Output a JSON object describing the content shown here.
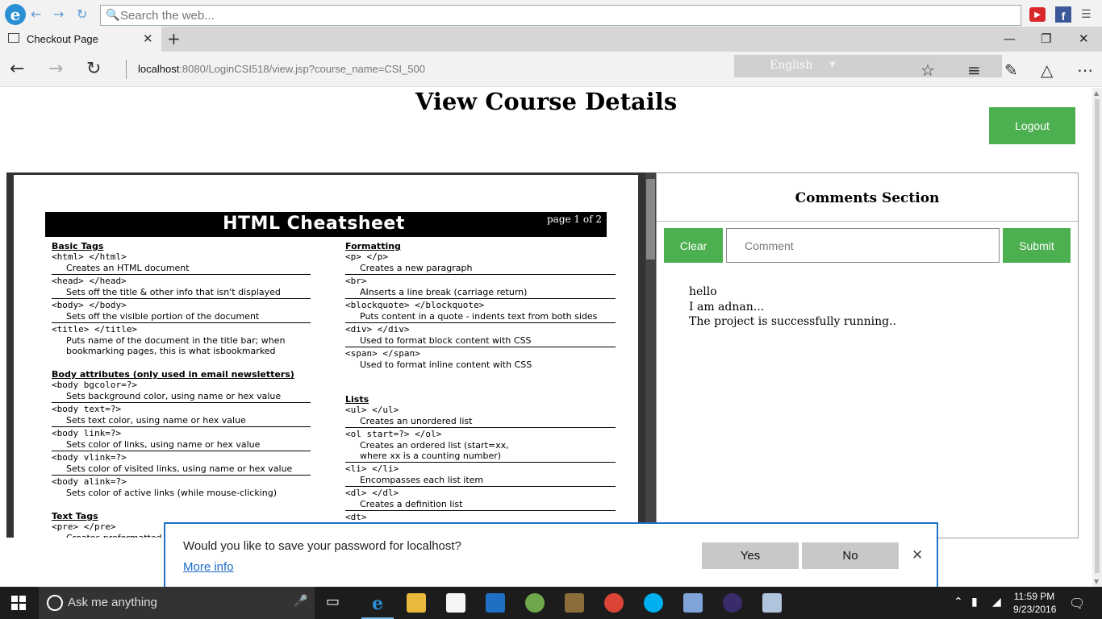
{
  "search": {
    "placeholder": "Search the web..."
  },
  "tab": {
    "title": "Checkout Page"
  },
  "address": {
    "host": "localhost",
    "rest": ":8080/LoginCSI518/view.jsp?course_name=CSI_500"
  },
  "toolbar": {
    "language": "English"
  },
  "page": {
    "title": "View Course Details",
    "logout_label": "Logout"
  },
  "cheatsheet": {
    "title": "HTML Cheatsheet",
    "page_label": "page 1 of 2",
    "left": [
      {
        "section": "Basic Tags",
        "entries": [
          {
            "tag": "<html> </html>",
            "desc": [
              "Creates an HTML document"
            ]
          },
          {
            "tag": "<head> </head>",
            "desc": [
              "Sets off the title & other info that isn't displayed"
            ]
          },
          {
            "tag": "<body> </body>",
            "desc": [
              "Sets off the visible portion of the document"
            ]
          },
          {
            "tag": "<title> </title>",
            "desc": [
              "Puts name of the document in the title bar; when",
              "bookmarking pages, this is what isbookmarked"
            ]
          }
        ]
      },
      {
        "section": "Body attributes",
        "section_extra": " (only used in email newsletters)",
        "entries": [
          {
            "tag": "<body bgcolor=?>",
            "desc": [
              "Sets background color, using name or hex value"
            ]
          },
          {
            "tag": "<body text=?>",
            "desc": [
              "Sets text color, using name or hex value"
            ]
          },
          {
            "tag": "<body link=?>",
            "desc": [
              "Sets color of links, using name or hex value"
            ]
          },
          {
            "tag": "<body vlink=?>",
            "desc": [
              "Sets color of visited links, using name or hex value"
            ]
          },
          {
            "tag": "<body alink=?>",
            "desc": [
              "Sets color of active links (while mouse-clicking)"
            ]
          }
        ]
      },
      {
        "section": "Text Tags",
        "entries": [
          {
            "tag": "<pre> </pre>",
            "desc": [
              "Creates preformatted"
            ]
          }
        ]
      }
    ],
    "right": [
      {
        "section": "Formatting",
        "entries": [
          {
            "tag": "<p> </p>",
            "desc": [
              "Creates a new paragraph"
            ]
          },
          {
            "tag": "<br>",
            "desc": [
              "AInserts a line break (carriage return)"
            ]
          },
          {
            "tag": "<blockquote> </blockquote>",
            "desc": [
              "Puts content in a quote - indents text from both sides"
            ]
          },
          {
            "tag": "<div> </div>",
            "desc": [
              "Used to format block content with CSS"
            ]
          },
          {
            "tag": "<span> </span>",
            "desc": [
              "Used to format inline content with CSS"
            ]
          }
        ]
      },
      {
        "section": "Lists",
        "entries": [
          {
            "tag": "<ul> </ul>",
            "desc": [
              "Creates an unordered list"
            ]
          },
          {
            "tag": "<ol start=?> </ol>",
            "desc": [
              "Creates an ordered list (start=xx,",
              "where xx is a counting number)"
            ]
          },
          {
            "tag": "<li> </li>",
            "desc": [
              "Encompasses each list item"
            ]
          },
          {
            "tag": "<dl> </dl>",
            "desc": [
              "Creates a definition list"
            ]
          },
          {
            "tag": "<dt>",
            "desc": []
          }
        ]
      }
    ]
  },
  "comments": {
    "title": "Comments Section",
    "clear_label": "Clear",
    "input_placeholder": "Comment",
    "submit_label": "Submit",
    "items": [
      "hello",
      "I am adnan...",
      "The project is successfully running.."
    ]
  },
  "password_prompt": {
    "message": "Would you like to save your password for localhost?",
    "more_info": "More info",
    "yes_label": "Yes",
    "no_label": "No"
  },
  "taskbar": {
    "search_placeholder": "Ask me anything",
    "time": "11:59 PM",
    "date": "9/23/2016"
  },
  "colors": {
    "accent_green": "#4caf50",
    "prompt_border": "#1e73c8",
    "link_blue": "#1e6cc8"
  }
}
